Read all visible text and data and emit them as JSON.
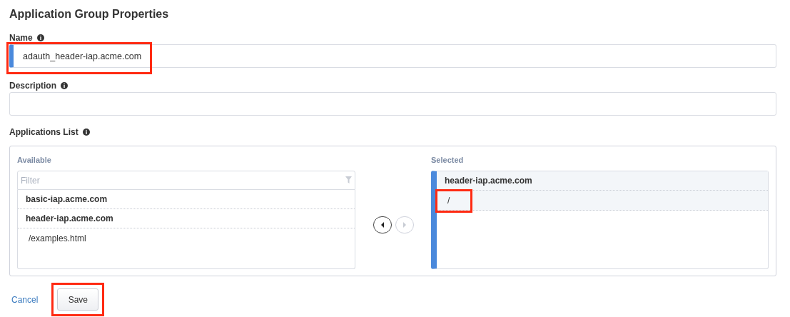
{
  "title": "Application Group Properties",
  "name_field": {
    "label": "Name",
    "value": "adauth_header-iap.acme.com",
    "highlighted": true
  },
  "description_field": {
    "label": "Description"
  },
  "applications": {
    "label": "Applications List",
    "available": {
      "label": "Available",
      "filter_placeholder": "Filter",
      "items": [
        {
          "kind": "group",
          "text": "basic-iap.acme.com"
        },
        {
          "kind": "group",
          "text": "header-iap.acme.com"
        },
        {
          "kind": "path",
          "text": "/examples.html"
        }
      ]
    },
    "move_buttons": [
      {
        "kind": "left",
        "disabled": false
      },
      {
        "kind": "right",
        "disabled": true
      }
    ],
    "selected": {
      "label": "Selected",
      "items": [
        {
          "kind": "group",
          "text": "header-iap.acme.com",
          "highlighted": false
        },
        {
          "kind": "path",
          "text": "/",
          "highlighted": true
        }
      ]
    }
  },
  "actions": {
    "cancel": "Cancel",
    "save": "Save",
    "save_highlighted": true
  }
}
